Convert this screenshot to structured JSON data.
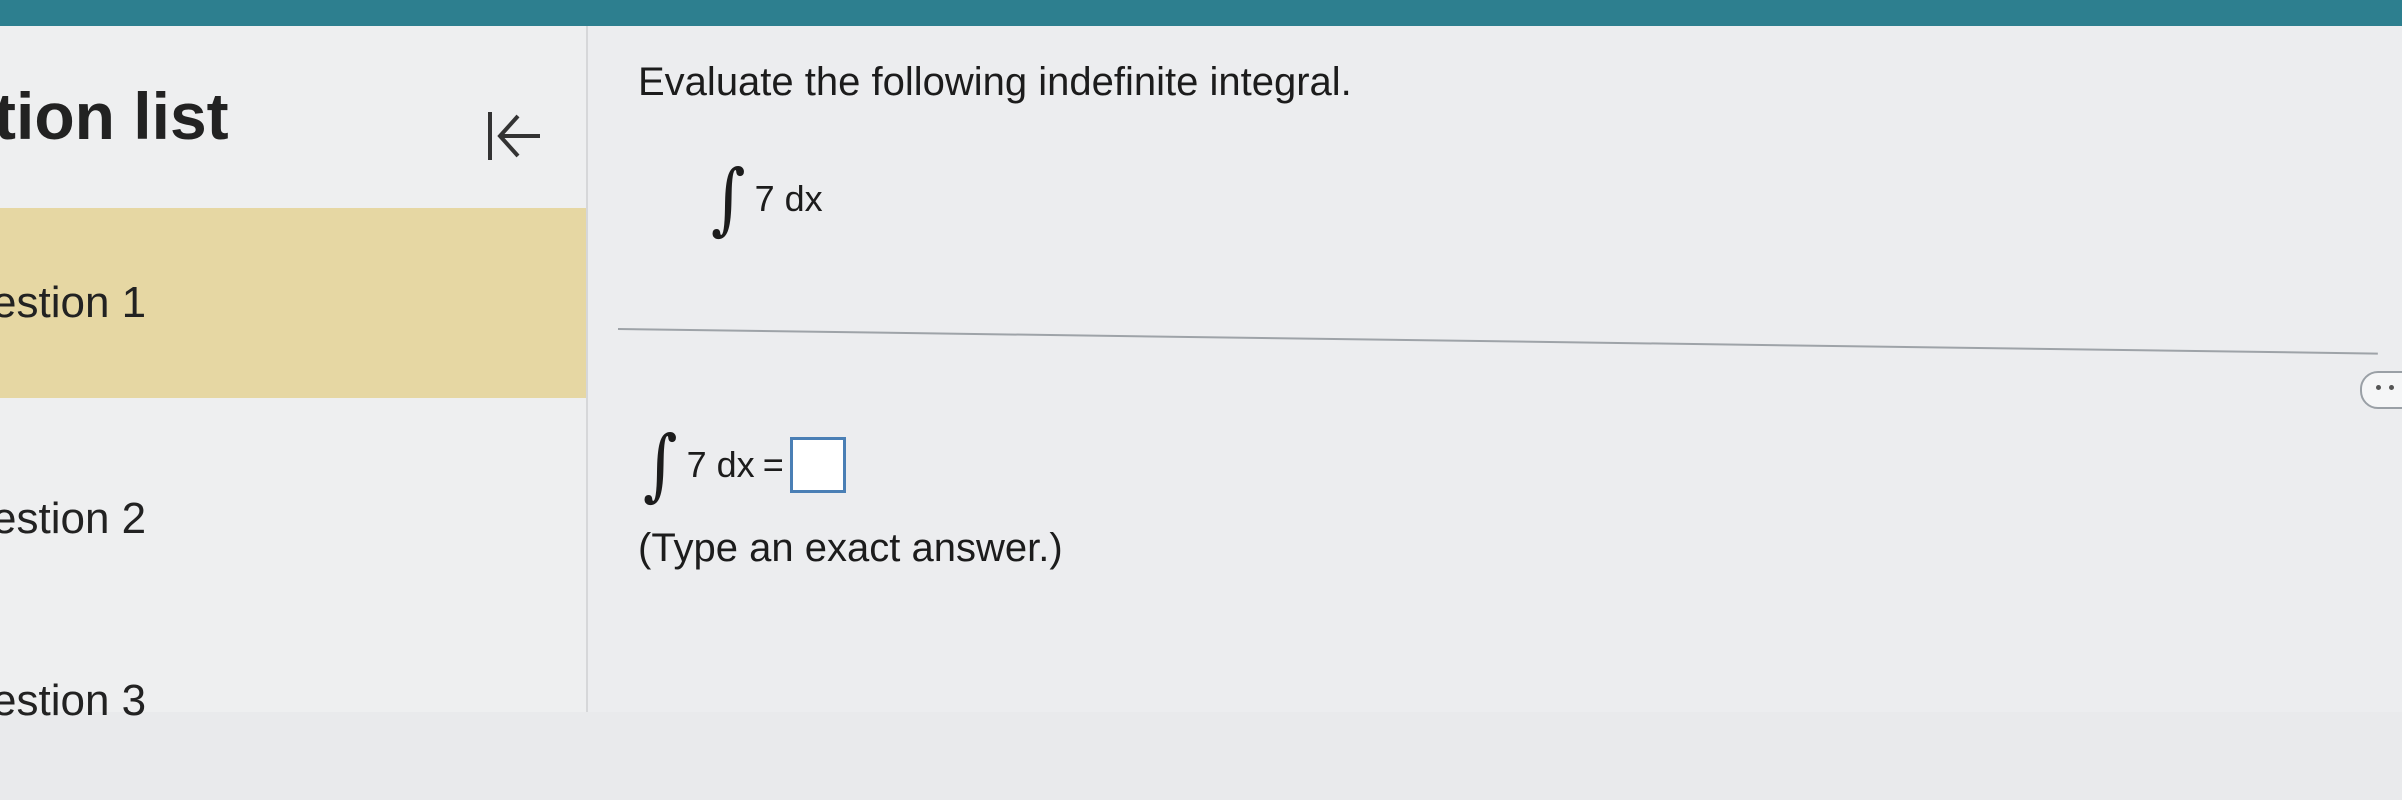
{
  "sidebar": {
    "title": "tion list",
    "items": [
      {
        "label": "estion 1",
        "active": true
      },
      {
        "label": "estion 2",
        "active": false
      },
      {
        "label": "estion 3",
        "active": false
      }
    ]
  },
  "question": {
    "prompt": "Evaluate the following indefinite integral.",
    "integral_sign": "∫",
    "integrand": "7 dx",
    "answer_lhs": "7 dx",
    "equals": "=",
    "answer_value": "",
    "hint": "(Type an exact answer.)"
  },
  "icons": {
    "collapse": "collapse-left-icon",
    "more": "more-options-icon"
  },
  "colors": {
    "topbar": "#2d7f8f",
    "active_item": "#e6d7a3",
    "answer_border": "#4a7fb5"
  }
}
